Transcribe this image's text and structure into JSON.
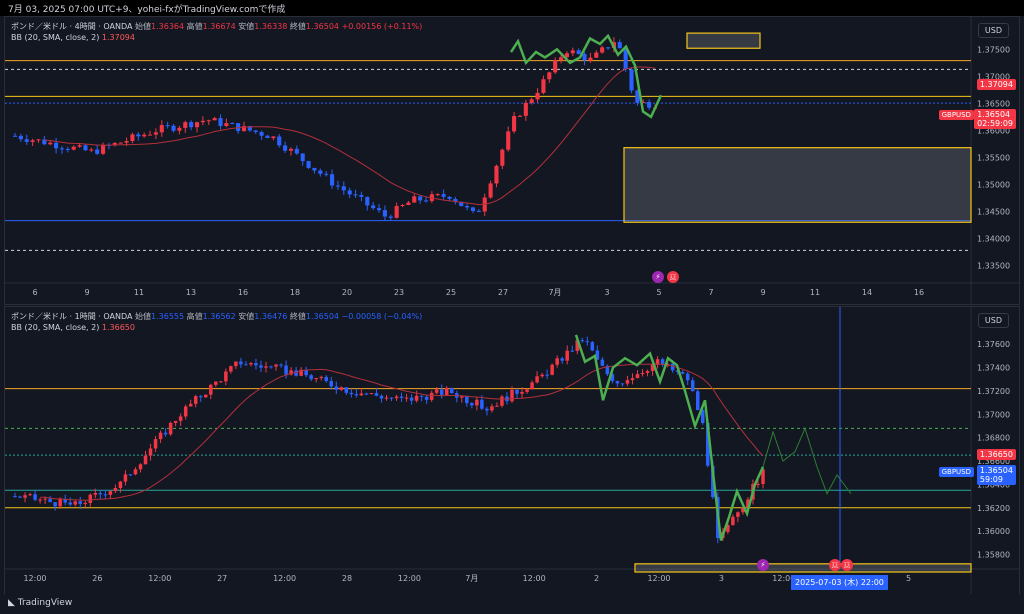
{
  "header": {
    "text": "7月 03, 2025 07:00 UTC+9、yohei-fxがTradingView.comで作成"
  },
  "panel1": {
    "title": "ポンド／米ドル · 4時間 · OANDA",
    "open_lbl": "始値",
    "open": "1.36364",
    "high_lbl": "高値",
    "high": "1.36674",
    "low_lbl": "安値",
    "low": "1.36338",
    "close_lbl": "終値",
    "close": "1.36504",
    "change": "+0.00156 (+0.11%)",
    "bb_label": "BB (20, SMA, close, 2)",
    "bb_value": "1.37094",
    "currency": "USD",
    "price_labels": [
      "1.37500",
      "1.37000",
      "1.36500",
      "1.36000",
      "1.35500",
      "1.35000",
      "1.34500",
      "1.34000",
      "1.33500"
    ],
    "price_range": [
      1.3325,
      1.3795
    ],
    "tag_bb": "1.37094",
    "tag_price": "1.36504",
    "tag_countdown": "02:59:09",
    "symbol_tag": "GBPUSD",
    "time_labels": [
      "6",
      "9",
      "11",
      "13",
      "16",
      "18",
      "20",
      "23",
      "25",
      "27",
      "7月",
      "3",
      "5",
      "7",
      "9",
      "11",
      "14",
      "16"
    ],
    "accent_up": "#f23645",
    "accent_down": "#2962ff",
    "bb_color": "#ff5a5a"
  },
  "panel2": {
    "title": "ポンド／米ドル · 1時間 · OANDA",
    "open_lbl": "始値",
    "open": "1.36555",
    "high_lbl": "高値",
    "high": "1.36562",
    "low_lbl": "安値",
    "low": "1.36476",
    "close_lbl": "終値",
    "close": "1.36504",
    "change": "−0.00058 (−0.04%)",
    "bb_label": "BB (20, SMA, close, 2)",
    "bb_value": "1.36650",
    "currency": "USD",
    "price_labels": [
      "1.37600",
      "1.37400",
      "1.37200",
      "1.37000",
      "1.36800",
      "1.36600",
      "1.36400",
      "1.36200",
      "1.36000",
      "1.35800"
    ],
    "price_range": [
      1.3571,
      1.3785
    ],
    "tag_bb": "1.36650",
    "tag_price": "1.36504",
    "tag_countdown": "59:09",
    "symbol_tag": "GBPUSD",
    "time_labels": [
      "12:00",
      "26",
      "12:00",
      "27",
      "12:00",
      "28",
      "12:00",
      "7月",
      "12:00",
      "2",
      "12:00",
      "3",
      "12:00",
      "12:00",
      "5"
    ],
    "crosshair_date": "2025-07-03 (木)  22:00"
  },
  "footer": {
    "brand": "TradingView"
  }
}
